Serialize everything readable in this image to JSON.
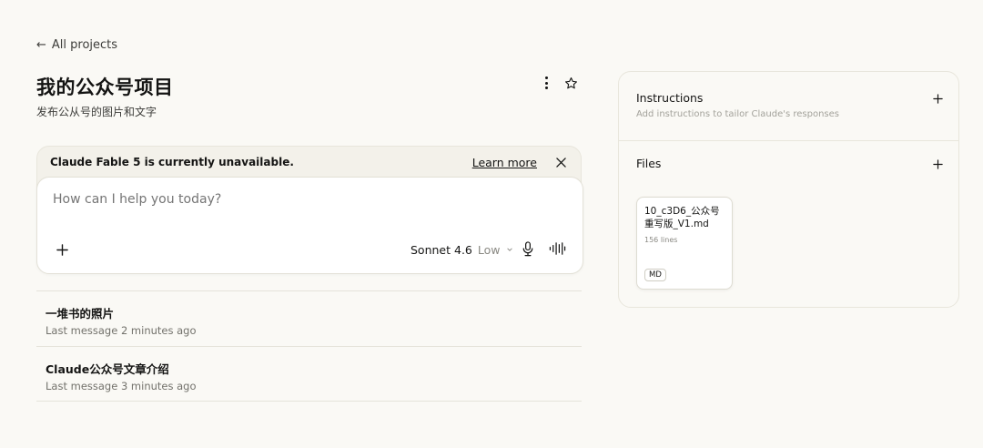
{
  "nav": {
    "back_arrow": "←",
    "back_label": "All projects"
  },
  "project": {
    "title": "我的公众号项目",
    "description": "发布公从号的图片和文字"
  },
  "banner": {
    "message": "Claude Fable 5 is currently unavailable.",
    "learn_more": "Learn more"
  },
  "composer": {
    "placeholder": "How can I help you today?",
    "model": "Sonnet 4.6",
    "effort": "Low"
  },
  "chats": [
    {
      "title": "一堆书的照片",
      "meta": "Last message 2 minutes ago"
    },
    {
      "title": "Claude公众号文章介绍",
      "meta": "Last message 3 minutes ago"
    }
  ],
  "panel": {
    "instructions_title": "Instructions",
    "instructions_hint": "Add instructions to tailor Claude's responses",
    "files_title": "Files",
    "files": [
      {
        "name": "10_c3D6_公众号重写版_V1.md",
        "lines": "156 lines",
        "type": "MD"
      }
    ]
  },
  "icons": [
    "arrow-left-icon",
    "more-vertical-icon",
    "star-icon",
    "close-icon",
    "plus-icon",
    "chevron-down-icon",
    "microphone-icon",
    "waveform-icon"
  ]
}
